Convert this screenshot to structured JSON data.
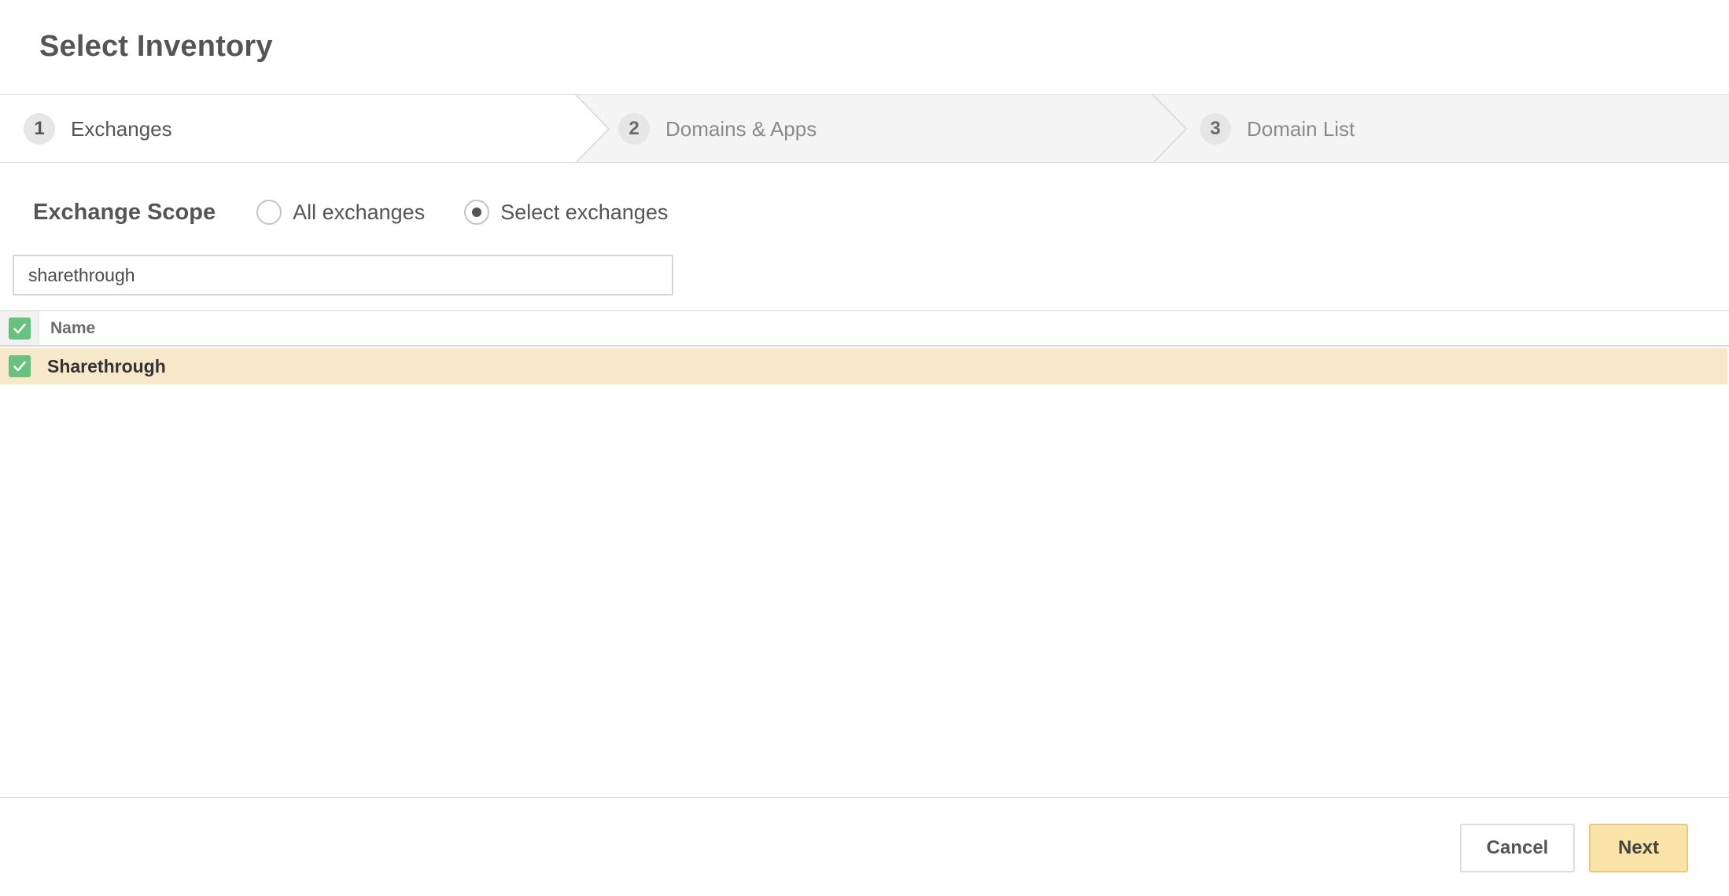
{
  "dialog": {
    "title": "Select Inventory"
  },
  "stepper": {
    "steps": [
      {
        "number": "1",
        "label": "Exchanges",
        "active": true
      },
      {
        "number": "2",
        "label": "Domains & Apps",
        "active": false
      },
      {
        "number": "3",
        "label": "Domain List",
        "active": false
      }
    ]
  },
  "scope": {
    "label": "Exchange Scope",
    "options": [
      {
        "label": "All exchanges",
        "checked": false
      },
      {
        "label": "Select exchanges",
        "checked": true
      }
    ]
  },
  "search": {
    "value": "sharethrough"
  },
  "table": {
    "header": {
      "name": "Name",
      "all_selected": true
    },
    "rows": [
      {
        "name": "Sharethrough",
        "selected": true
      }
    ]
  },
  "footer": {
    "cancel_label": "Cancel",
    "next_label": "Next"
  },
  "colors": {
    "accent": "#fae3a6",
    "selected_row": "#f7e8c9",
    "checkbox": "#66c27c"
  }
}
